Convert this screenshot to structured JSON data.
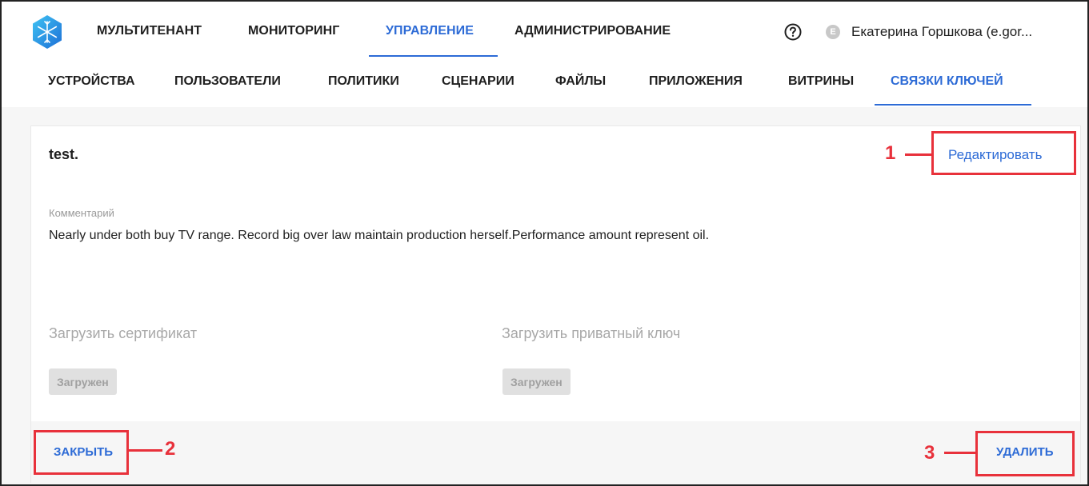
{
  "topnav": {
    "items": [
      {
        "label": "МУЛЬТИТЕНАНТ"
      },
      {
        "label": "МОНИТОРИНГ"
      },
      {
        "label": "УПРАВЛЕНИЕ"
      },
      {
        "label": "АДМИНИСТРИРОВАНИЕ"
      }
    ],
    "active": "УПРАВЛЕНИЕ"
  },
  "user": {
    "avatar_letter": "E",
    "name": "Екатерина Горшкова (e.gor..."
  },
  "subnav": {
    "items": [
      {
        "label": "УСТРОЙСТВА"
      },
      {
        "label": "ПОЛЬЗОВАТЕЛИ"
      },
      {
        "label": "ПОЛИТИКИ"
      },
      {
        "label": "СЦЕНАРИИ"
      },
      {
        "label": "ФАЙЛЫ"
      },
      {
        "label": "ПРИЛОЖЕНИЯ"
      },
      {
        "label": "ВИТРИНЫ"
      },
      {
        "label": "СВЯЗКИ КЛЮЧЕЙ"
      }
    ],
    "active": "СВЯЗКИ КЛЮЧЕЙ"
  },
  "keychain": {
    "title": "test.",
    "edit_label": "Редактировать",
    "comment_label": "Комментарий",
    "comment": "Nearly under both buy TV range. Record big over law maintain production herself.Performance amount represent oil.",
    "certificate": {
      "label": "Загрузить сертификат",
      "status": "Загружен"
    },
    "private_key": {
      "label": "Загрузить приватный ключ",
      "status": "Загружен"
    },
    "close_label": "ЗАКРЫТЬ",
    "delete_label": "УДАЛИТЬ"
  },
  "annotations": [
    {
      "number": "1"
    },
    {
      "number": "2"
    },
    {
      "number": "3"
    }
  ],
  "colors": {
    "accent": "#2d6bd6",
    "annotation": "#e8313b",
    "text": "#1f1f1f",
    "muted": "#a8a8a8"
  },
  "icons": {
    "logo": "snowflake-logo-icon",
    "help": "question-circle-icon"
  }
}
